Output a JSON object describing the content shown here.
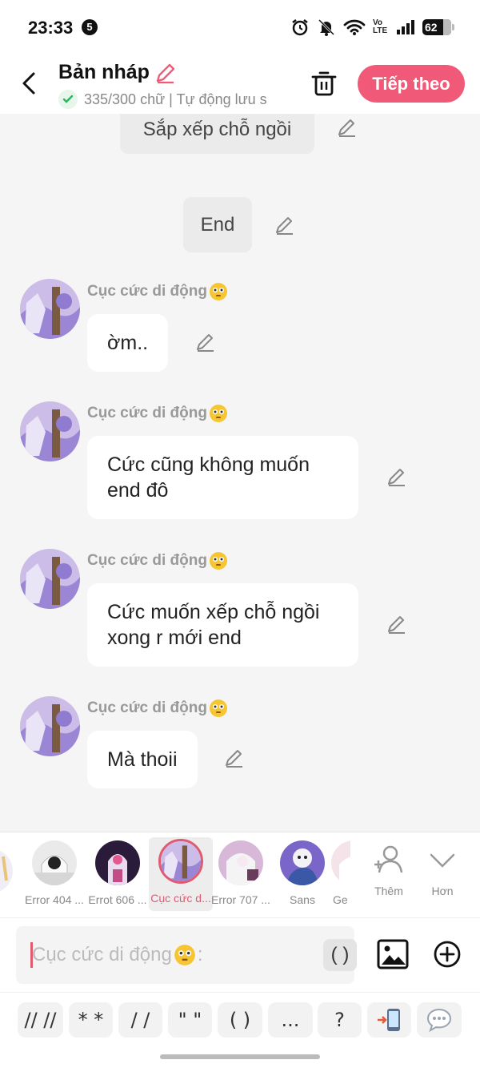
{
  "status_bar": {
    "time": "23:33",
    "notification_count": "5",
    "network": "Vo LTE",
    "battery": "62"
  },
  "header": {
    "title": "Bản nháp",
    "word_count": "335/300 chữ",
    "autosave": "Tự động lưu s",
    "next_label": "Tiếp theo",
    "accent": "#f05a78"
  },
  "chat": {
    "narrations": [
      {
        "text": "Sắp xếp chỗ ngồi"
      },
      {
        "text": "End"
      }
    ],
    "messages": [
      {
        "sender": "Cục cức di động",
        "text": "ờm.."
      },
      {
        "sender": "Cục cức di động",
        "text": "Cức cũng không muốn end đô"
      },
      {
        "sender": "Cục cức di động",
        "text": "Cức muốn xếp chỗ ngồi xong r mới end"
      },
      {
        "sender": "Cục cức di động",
        "text": "Mà thoii"
      }
    ]
  },
  "characters": {
    "items": [
      {
        "name": "Error 404 ..."
      },
      {
        "name": "Errot 606 ..."
      },
      {
        "name": "Cục cức d...",
        "selected": true
      },
      {
        "name": "Error 707 ..."
      },
      {
        "name": "Sans"
      },
      {
        "name": "Ge"
      }
    ],
    "add_label": "Thêm",
    "more_label": "Hơn"
  },
  "input": {
    "placeholder": "Cục cức di động",
    "placeholder_suffix": ":",
    "paren_label": "( )"
  },
  "quick_keys": [
    "// //",
    "* *",
    "/ /",
    "\" \"",
    "( )",
    "...",
    "?"
  ]
}
